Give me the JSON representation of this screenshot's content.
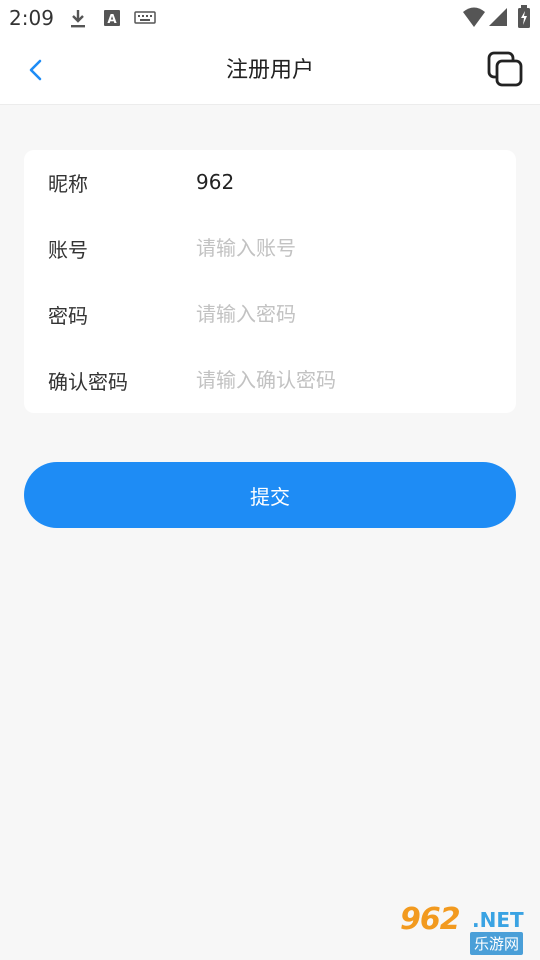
{
  "status_bar": {
    "time": "2:09",
    "icons": [
      "download-icon",
      "a-letter-icon",
      "keyboard-icon",
      "wifi-icon",
      "signal-icon",
      "battery-icon"
    ]
  },
  "nav": {
    "title": "注册用户",
    "back_icon": "chevron-left-icon",
    "action_icon": "copy-icon",
    "accent_color": "#1e8cf5"
  },
  "form": {
    "fields": [
      {
        "label": "昵称",
        "value": "962",
        "placeholder": ""
      },
      {
        "label": "账号",
        "value": "",
        "placeholder": "请输入账号"
      },
      {
        "label": "密码",
        "value": "",
        "placeholder": "请输入密码"
      },
      {
        "label": "确认密码",
        "value": "",
        "placeholder": "请输入确认密码"
      }
    ]
  },
  "submit": {
    "label": "提交",
    "color": "#1e8cf5"
  },
  "watermark": {
    "number": "962",
    "suffix": ".NET",
    "subtitle": "乐游网"
  }
}
